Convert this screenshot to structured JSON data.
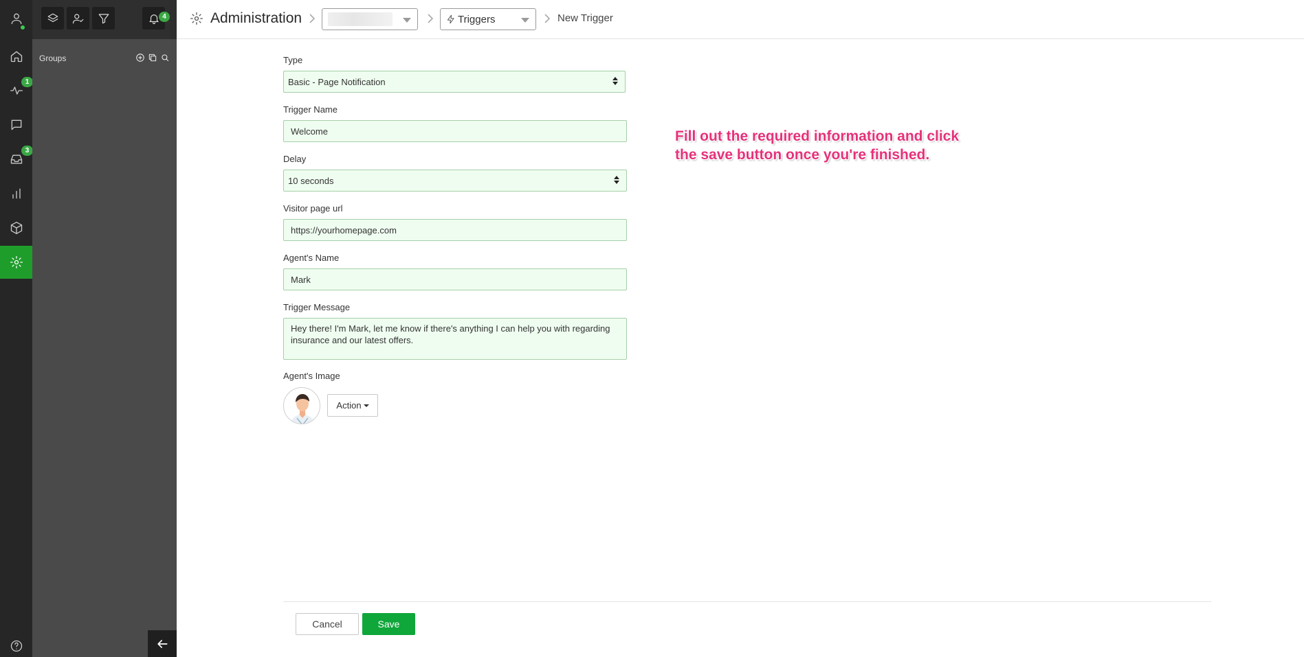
{
  "rail": {
    "items": [
      {
        "icon": "user-avatar-icon",
        "badge": ""
      },
      {
        "icon": "home-icon",
        "badge": ""
      },
      {
        "icon": "activity-icon",
        "badge": "1"
      },
      {
        "icon": "chat-icon",
        "badge": ""
      },
      {
        "icon": "inbox-icon",
        "badge": "3"
      },
      {
        "icon": "reports-icon",
        "badge": ""
      },
      {
        "icon": "package-icon",
        "badge": ""
      },
      {
        "icon": "settings-icon",
        "badge": ""
      },
      {
        "icon": "help-icon",
        "badge": ""
      }
    ],
    "active_item": "settings-icon",
    "active_color": "#1f9d2b"
  },
  "panel": {
    "notifications_badge": "4",
    "groups_label": "Groups"
  },
  "header": {
    "title": "Administration",
    "selector_1_value": "",
    "selector_2_value": "Triggers",
    "current_page": "New Trigger"
  },
  "form": {
    "type_label": "Type",
    "type_value": "Basic - Page Notification",
    "trigger_name_label": "Trigger Name",
    "trigger_name_value": "Welcome",
    "delay_label": "Delay",
    "delay_value": "10 seconds",
    "visitor_url_label": "Visitor page url",
    "visitor_url_value": "https://yourhomepage.com",
    "agent_name_label": "Agent's Name",
    "agent_name_value": "Mark",
    "trigger_message_label": "Trigger Message",
    "trigger_message_value": "Hey there! I'm Mark, let me know if there's anything I can help you with regarding insurance and our latest offers.",
    "agent_image_label": "Agent's Image",
    "action_label": "Action",
    "field_bg_color": "#effdf0"
  },
  "annotation": {
    "line1": "Fill out the required information and click",
    "line2": "the save button once you're finished.",
    "color": "#e5317a"
  },
  "footer": {
    "cancel_label": "Cancel",
    "save_label": "Save",
    "save_color": "#0fa63a"
  }
}
